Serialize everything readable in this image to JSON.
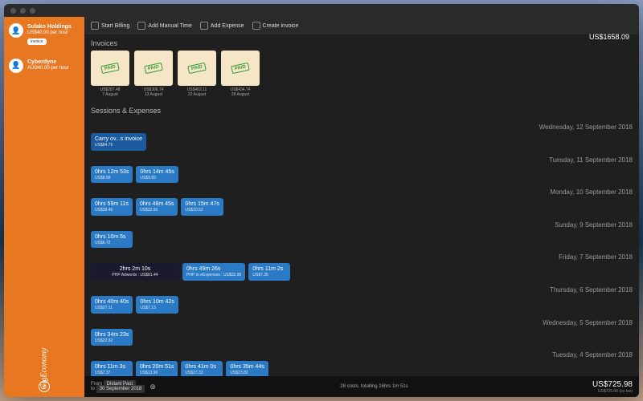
{
  "brand": "GigEconomy",
  "clients": [
    {
      "name": "Sulako Holdings",
      "rate": "US$40.00 per hour",
      "badge": "invoice"
    },
    {
      "name": "Cyberdyne",
      "rate": "AUD40.00 per hour"
    }
  ],
  "toolbar": {
    "start": "Start Billing",
    "manual": "Add Manual Time",
    "expense": "Add Expense",
    "invoice": "Create invoice"
  },
  "top_total": "US$1658.09",
  "sections": {
    "invoices": "Invoices",
    "sessions": "Sessions & Expenses"
  },
  "invoices": [
    {
      "amt": "US$287.48",
      "date": "7 August"
    },
    {
      "amt": "US$306.74",
      "date": "13 August"
    },
    {
      "amt": "US$462.11",
      "date": "22 August"
    },
    {
      "amt": "US$434.74",
      "date": "28 August"
    }
  ],
  "paid_label": "PAID",
  "days": [
    {
      "heading": "Wednesday, 12 September 2018",
      "items": [
        {
          "type": "carry",
          "l1": "Carry ov...s invoice",
          "l2": "US$84.76"
        }
      ]
    },
    {
      "heading": "Tuesday, 11 September 2018",
      "items": [
        {
          "l1": "0hrs 12m 53s",
          "l2": "US$8.58"
        },
        {
          "l1": "0hrs 14m 45s",
          "l2": "US$9.83"
        }
      ]
    },
    {
      "heading": "Monday, 10 September 2018",
      "items": [
        {
          "l1": "0hrs 59m 11s",
          "l2": "US$39.46"
        },
        {
          "l1": "0hrs 48m 45s",
          "l2": "US$32.50"
        },
        {
          "l1": "0hrs 15m 47s",
          "l2": "US$10.52"
        }
      ]
    },
    {
      "heading": "Sunday, 9 September 2018",
      "items": [
        {
          "l1": "0hrs 10m 5s",
          "l2": "US$6.72"
        }
      ]
    },
    {
      "heading": "Friday, 7 September 2018",
      "items": [
        {
          "type": "dark",
          "l1": "2hrs 2m 10s",
          "l2": "PHP Adwords : US$81.44"
        },
        {
          "l1": "0hrs 49m 26s",
          "l2": "PHP to eExpenses : US$32.95"
        },
        {
          "l1": "0hrs 11m 2s",
          "l2": "US$7.35"
        }
      ]
    },
    {
      "heading": "Thursday, 6 September 2018",
      "items": [
        {
          "l1": "0hrs 40m 40s",
          "l2": "US$27.11"
        },
        {
          "l1": "0hrs 10m 42s",
          "l2": "US$7.13"
        }
      ]
    },
    {
      "heading": "Wednesday, 5 September 2018",
      "items": [
        {
          "l1": "0hrs 34m 23s",
          "l2": "US$22.92"
        }
      ]
    },
    {
      "heading": "Tuesday, 4 September 2018",
      "items": [
        {
          "l1": "0hrs 11m 3s",
          "l2": "US$7.37"
        },
        {
          "l1": "0hrs 20m 51s",
          "l2": "US$13.90"
        },
        {
          "l1": "0hrs 41m 0s",
          "l2": "US$27.33"
        },
        {
          "l1": "0hrs 35m 44s",
          "l2": "US$23.82"
        }
      ]
    }
  ],
  "footer": {
    "from_label": "From",
    "to_label": "to",
    "from": "Distant Past",
    "to": "30 September 2018",
    "summary": "28 costs, totalling 16hrs 1m 51s",
    "amount": "US$725.98",
    "tax": "US$725.98 (ex tax)"
  }
}
